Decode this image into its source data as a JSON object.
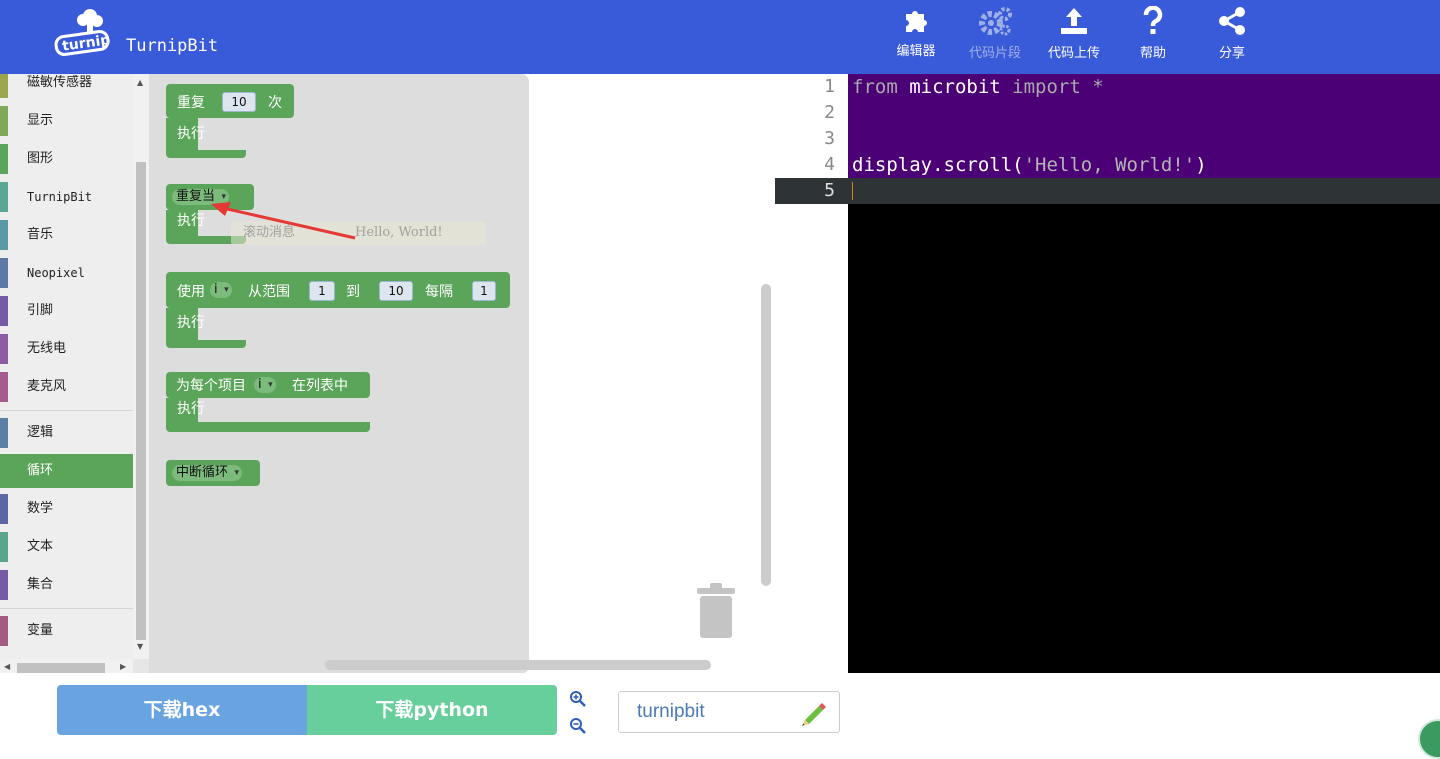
{
  "header": {
    "brand": "TurnipBit",
    "nav": [
      {
        "label": "编辑器",
        "icon": "puzzle-icon"
      },
      {
        "label": "代码片段",
        "icon": "gears-icon",
        "disabled": true
      },
      {
        "label": "代码上传",
        "icon": "upload-icon"
      },
      {
        "label": "帮助",
        "icon": "question-icon"
      },
      {
        "label": "分享",
        "icon": "share-icon"
      }
    ],
    "colors": {
      "background": "#3a5bd9"
    }
  },
  "sidebar": {
    "categories": [
      {
        "label": "磁敏传感器",
        "color": "#9ea54f"
      },
      {
        "label": "显示",
        "color": "#7fa858"
      },
      {
        "label": "图形",
        "color": "#5ba55b"
      },
      {
        "label": "TurnipBit",
        "color": "#5ba595"
      },
      {
        "label": "音乐",
        "color": "#5b9aa5"
      },
      {
        "label": "Neopixel",
        "color": "#5b7aa5"
      },
      {
        "label": "引脚",
        "color": "#745ba5"
      },
      {
        "label": "无线电",
        "color": "#8e5ba5"
      },
      {
        "label": "麦克风",
        "color": "#a55b8e"
      },
      {
        "label": "逻辑",
        "color": "#5b80a5"
      },
      {
        "label": "循环",
        "color": "#5ba55b",
        "active": true
      },
      {
        "label": "数学",
        "color": "#5b67a5"
      },
      {
        "label": "文本",
        "color": "#5ba58c"
      },
      {
        "label": "集合",
        "color": "#745ba5"
      },
      {
        "label": "变量",
        "color": "#a55b80"
      }
    ]
  },
  "blocks": {
    "repeat": {
      "label": "重复",
      "times": "10",
      "suffix": "次",
      "do": "执行"
    },
    "while": {
      "label": "重复当",
      "do": "执行"
    },
    "ghost": {
      "label": "滚动消息",
      "text": "Hello, World!"
    },
    "for_range": {
      "label": "使用",
      "var": "i",
      "from_label": "从范围",
      "from": "1",
      "to_label": "到",
      "to": "10",
      "step_label": "每隔",
      "step": "1",
      "do": "执行"
    },
    "for_each": {
      "label": "为每个项目",
      "var": "i",
      "in_label": "在列表中",
      "do": "执行"
    },
    "break": {
      "label": "中断循环"
    }
  },
  "editor": {
    "line_numbers": [
      "1",
      "2",
      "3",
      "4",
      "5"
    ],
    "lines": [
      {
        "kw1": "from",
        "mod": " microbit ",
        "kw2": "import",
        "star": " *"
      },
      {
        "text": ""
      },
      {
        "text": ""
      },
      {
        "fn": "display.scroll(",
        "str": "'Hello, World!'",
        "close": ")"
      },
      {
        "text": ""
      }
    ],
    "colors": {
      "code_bg": "#4b0076",
      "active_line": "#2e3436"
    }
  },
  "bottom": {
    "download_hex": "下载hex",
    "download_python": "下载python",
    "project_name": "turnipbit",
    "colors": {
      "hex": "#6aa4e0",
      "python": "#67cf9b"
    }
  }
}
